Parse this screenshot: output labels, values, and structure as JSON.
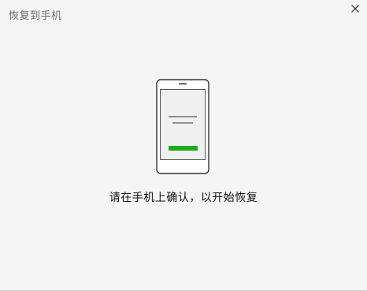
{
  "window": {
    "title": "恢复到手机"
  },
  "dialog": {
    "message": "请在手机上确认，以开始恢复"
  },
  "colors": {
    "background": "#f5f5f5",
    "phone_stroke": "#333333",
    "screen_fill": "#f0f0f0",
    "line_color": "#8a8a8a",
    "accent_button": "#1aad19"
  },
  "icons": {
    "close": "close-icon",
    "illustration": "phone-confirm-illustration"
  }
}
